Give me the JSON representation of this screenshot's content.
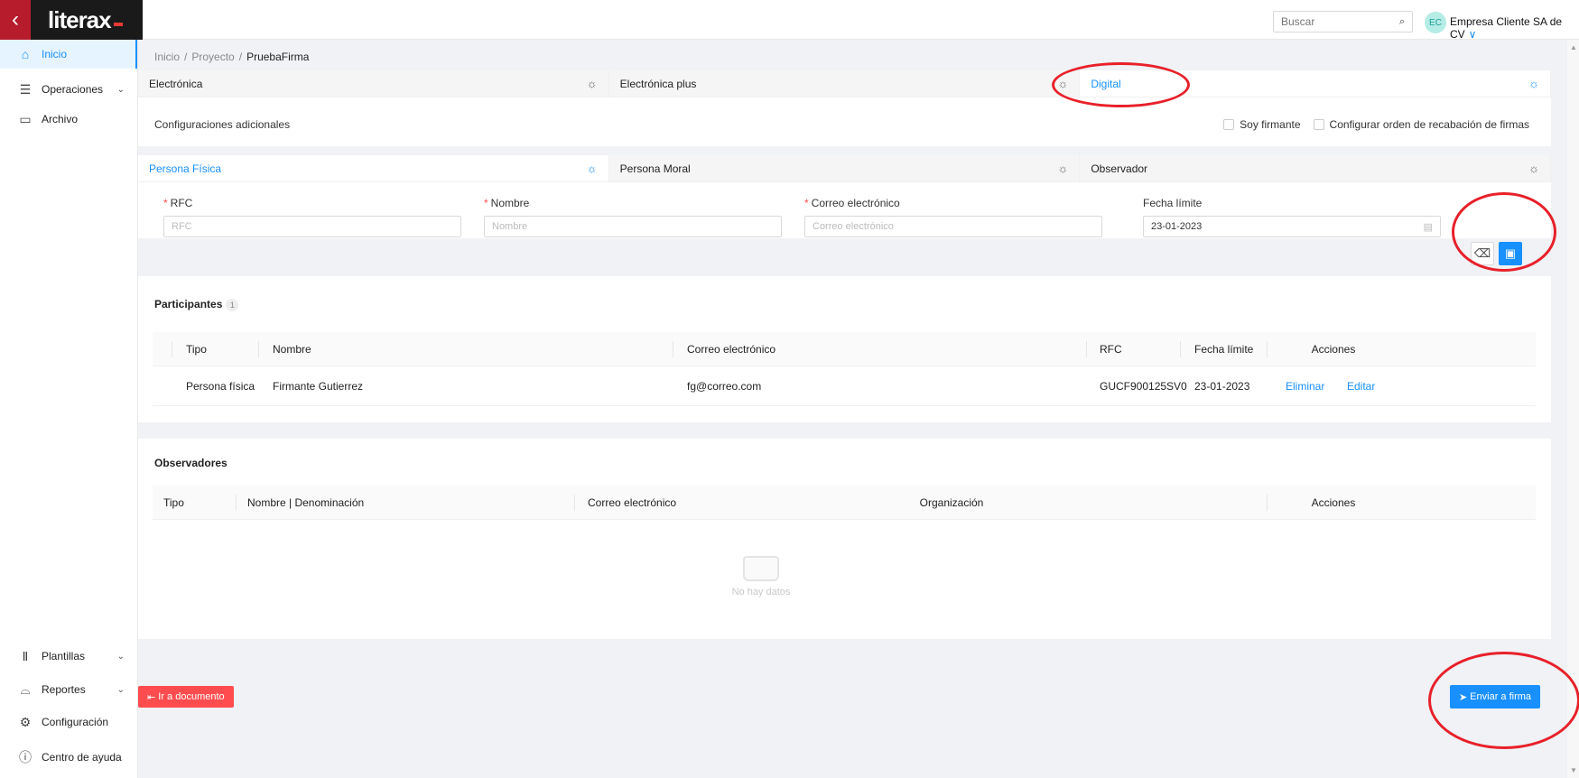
{
  "topbar": {
    "back_icon": "chevron-left-icon",
    "logo_text": "literax",
    "search_placeholder": "Buscar",
    "avatar_initials": "EC",
    "company": "Empresa Cliente SA de CV"
  },
  "sidebar": {
    "items": [
      {
        "label": "Inicio",
        "icon": "home-icon"
      },
      {
        "label": "Operaciones",
        "icon": "server-icon"
      },
      {
        "label": "Archivo",
        "icon": "folder-icon"
      },
      {
        "label": "Plantillas",
        "icon": "library-icon"
      },
      {
        "label": "Reportes",
        "icon": "chart-icon"
      },
      {
        "label": "Configuración",
        "icon": "gear-icon"
      },
      {
        "label": "Centro de ayuda",
        "icon": "help-icon"
      }
    ]
  },
  "breadcrumb": [
    "Inicio",
    "Proyecto",
    "PruebaFirma"
  ],
  "sign_tabs": [
    "Electrónica",
    "Electrónica plus",
    "Digital"
  ],
  "config": {
    "label": "Configuraciones adicionales",
    "soy_firmante": "Soy firmante",
    "orden": "Configurar orden de recabación de firmas"
  },
  "person_tabs": [
    "Persona Física",
    "Persona Moral",
    "Observador"
  ],
  "form": {
    "rfc_label": "RFC",
    "rfc_placeholder": "RFC",
    "nombre_label": "Nombre",
    "nombre_placeholder": "Nombre",
    "correo_label": "Correo electrónico",
    "correo_placeholder": "Correo electrónico",
    "fecha_label": "Fecha límite",
    "fecha_value": "23-01-2023"
  },
  "participantes": {
    "title": "Participantes",
    "count": "1",
    "headers": [
      "Tipo",
      "Nombre",
      "Correo electrónico",
      "RFC",
      "Fecha límite",
      "Acciones"
    ],
    "rows": [
      {
        "tipo": "Persona física",
        "nombre": "Firmante Gutierrez",
        "correo": "fg@correo.com",
        "rfc": "GUCF900125SV0",
        "fecha": "23-01-2023",
        "eliminar": "Eliminar",
        "editar": "Editar"
      }
    ]
  },
  "observadores": {
    "title": "Observadores",
    "headers": [
      "Tipo",
      "Nombre | Denominación",
      "Correo electrónico",
      "Organización",
      "Acciones"
    ],
    "empty_text": "No hay datos"
  },
  "actions": {
    "back_label": "Ir a documento",
    "send_label": "Enviar a firma"
  },
  "colors": {
    "primary": "#1890ff",
    "danger": "#ff4d4f",
    "brand_red": "#b71c2c",
    "annotation": "#e8202a"
  }
}
